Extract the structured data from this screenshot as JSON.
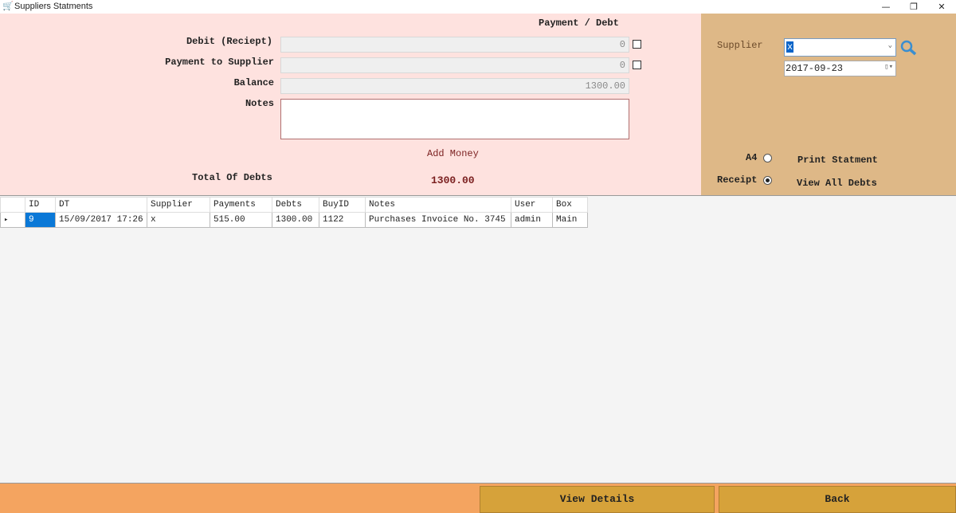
{
  "window": {
    "title": "Suppliers Statments",
    "icon": "cart-icon"
  },
  "form": {
    "section_title": "Payment / Debt",
    "debit_label": "Debit (Reciept)",
    "debit_value": "0",
    "payment_label": "Payment to Supplier",
    "payment_value": "0",
    "balance_label": "Balance",
    "balance_value": "1300.00",
    "notes_label": "Notes",
    "notes_value": "",
    "add_money": "Add Money",
    "total_label": "Total Of Debts",
    "total_value": "1300.00"
  },
  "side": {
    "supplier_label": "Supplier",
    "supplier_value": "x",
    "date_value": "2017-09-23",
    "a4_label": "A4",
    "receipt_label": "Receipt",
    "selected_format": "Receipt",
    "print_label": "Print Statment",
    "view_all_label": "View All Debts"
  },
  "grid": {
    "columns": [
      "ID",
      "DT",
      "Supplier",
      "Payments",
      "Debts",
      "BuyID",
      "Notes",
      "User",
      "Box"
    ],
    "rows": [
      [
        "9",
        "15/09/2017 17:26",
        "x",
        "515.00",
        "1300.00",
        "1122",
        "Purchases Invoice No. 3745",
        "admin",
        "Main"
      ]
    ]
  },
  "footer": {
    "view_details": "View Details",
    "back": "Back"
  },
  "colors": {
    "form_bg": "#fee2df",
    "side_bg": "#deb887",
    "footer_bg": "#f4a460",
    "button_bg": "#d6a23a",
    "accent_text": "#7a1f1f"
  }
}
